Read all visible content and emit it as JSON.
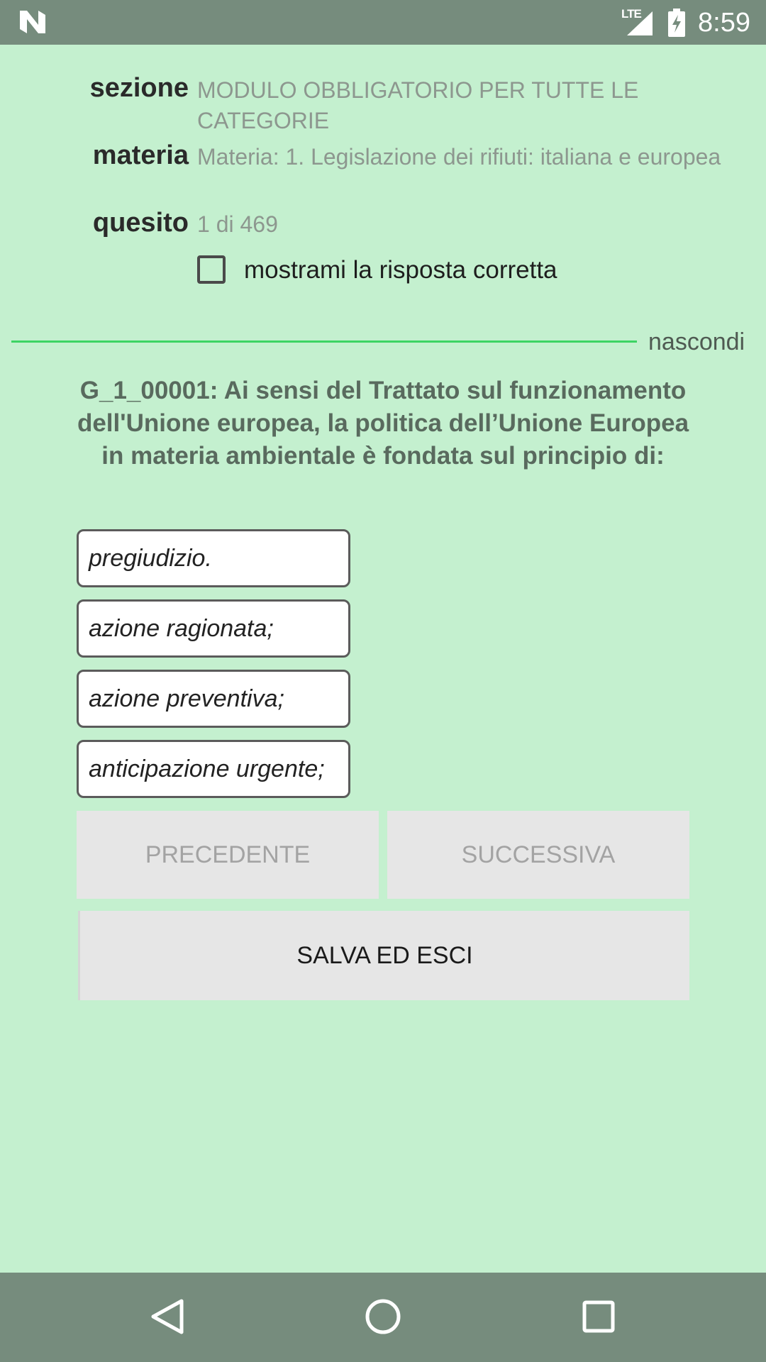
{
  "status_bar": {
    "network": "LTE",
    "time": "8:59",
    "icons": [
      "app-logo-icon",
      "signal-icon",
      "battery-charging-icon"
    ]
  },
  "info": {
    "section_label": "sezione",
    "section_value": "MODULO OBBLIGATORIO PER TUTTE LE CATEGORIE",
    "subject_label": "materia",
    "subject_value": "Materia: 1. Legislazione dei rifiuti: italiana e europea",
    "question_label": "quesito",
    "question_value": "1 di 469"
  },
  "show_answer": {
    "label": "mostrami la risposta corretta",
    "checked": false
  },
  "hide_link": "nascondi",
  "accent_colors": {
    "background": "#c4f0cf",
    "bars": "#768c7d",
    "divider": "#3dd464"
  },
  "question_text": "G_1_00001: Ai sensi del Trattato sul funzionamento dell'Unione europea, la politica dell’Unione Europea in materia ambientale è fondata sul principio di:",
  "answers": [
    "pregiudizio.",
    "azione ragionata;",
    "azione preventiva;",
    "anticipazione urgente;"
  ],
  "buttons": {
    "previous": "PRECEDENTE",
    "next": "SUCCESSIVA",
    "save_exit": "SALVA ED ESCI"
  },
  "nav_bar": {
    "icons": [
      "back-icon",
      "home-icon",
      "recents-icon"
    ]
  }
}
